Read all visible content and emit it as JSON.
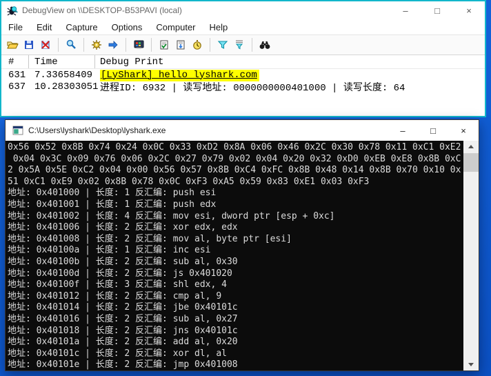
{
  "colors": {
    "debugview_border": "#12b7cb",
    "desktop_blue": "#115fd6",
    "highlight_yellow": "#ffff00",
    "console_background": "#0c0c0c",
    "console_text": "#dcdcdc"
  },
  "debugview": {
    "title": "DebugView on \\\\DESKTOP-B53PAVI (local)",
    "window_controls": {
      "minimize": "–",
      "maximize": "□",
      "close": "×"
    },
    "menu": [
      "File",
      "Edit",
      "Capture",
      "Options",
      "Computer",
      "Help"
    ],
    "toolbar_icons": [
      "open-folder",
      "save",
      "log-to-file",
      "magnifier",
      "capture",
      "passthrough-arrow",
      "computer",
      "clear-display",
      "omit-history",
      "clock",
      "filter",
      "highlight-filter",
      "find-binoculars"
    ],
    "table": {
      "columns": [
        "#",
        "Time",
        "Debug Print"
      ],
      "rows": [
        {
          "id": "631",
          "time": "7.33658409",
          "message": "[LyShark] hello lyshark.com"
        },
        {
          "id": "637",
          "time": "10.28303051",
          "message": "进程ID: 6932 | 读写地址: 0000000000401000 | 读写长度: 64"
        }
      ]
    }
  },
  "console": {
    "title": "C:\\Users\\lyshark\\Desktop\\lyshark.exe",
    "window_controls": {
      "minimize": "–",
      "maximize": "□",
      "close": "×"
    },
    "lines": [
      "0x56 0x52 0x8B 0x74 0x24 0x0C 0x33 0xD2 0x8A 0x06 0x46 0x2C 0x30 0x78 0x11 0xC1 0xE2",
      " 0x04 0x3C 0x09 0x76 0x06 0x2C 0x27 0x79 0x02 0x04 0x20 0x32 0xD0 0xEB 0xE8 0x8B 0xC",
      "2 0x5A 0x5E 0xC2 0x04 0x00 0x56 0x57 0x8B 0xC4 0xFC 0x8B 0x48 0x14 0x8B 0x70 0x10 0x",
      "51 0xC1 0xE9 0x02 0x8B 0x78 0x0C 0xF3 0xA5 0x59 0x83 0xE1 0x03 0xF3",
      "地址: 0x401000 | 长度: 1 反汇编: push esi",
      "地址: 0x401001 | 长度: 1 反汇编: push edx",
      "地址: 0x401002 | 长度: 4 反汇编: mov esi, dword ptr [esp + 0xc]",
      "地址: 0x401006 | 长度: 2 反汇编: xor edx, edx",
      "地址: 0x401008 | 长度: 2 反汇编: mov al, byte ptr [esi]",
      "地址: 0x40100a | 长度: 1 反汇编: inc esi",
      "地址: 0x40100b | 长度: 2 反汇编: sub al, 0x30",
      "地址: 0x40100d | 长度: 2 反汇编: js 0x401020",
      "地址: 0x40100f | 长度: 3 反汇编: shl edx, 4",
      "地址: 0x401012 | 长度: 2 反汇编: cmp al, 9",
      "地址: 0x401014 | 长度: 2 反汇编: jbe 0x40101c",
      "地址: 0x401016 | 长度: 2 反汇编: sub al, 0x27",
      "地址: 0x401018 | 长度: 2 反汇编: jns 0x40101c",
      "地址: 0x40101a | 长度: 2 反汇编: add al, 0x20",
      "地址: 0x40101c | 长度: 2 反汇编: xor dl, al",
      "地址: 0x40101e | 长度: 2 反汇编: jmp 0x401008"
    ]
  }
}
